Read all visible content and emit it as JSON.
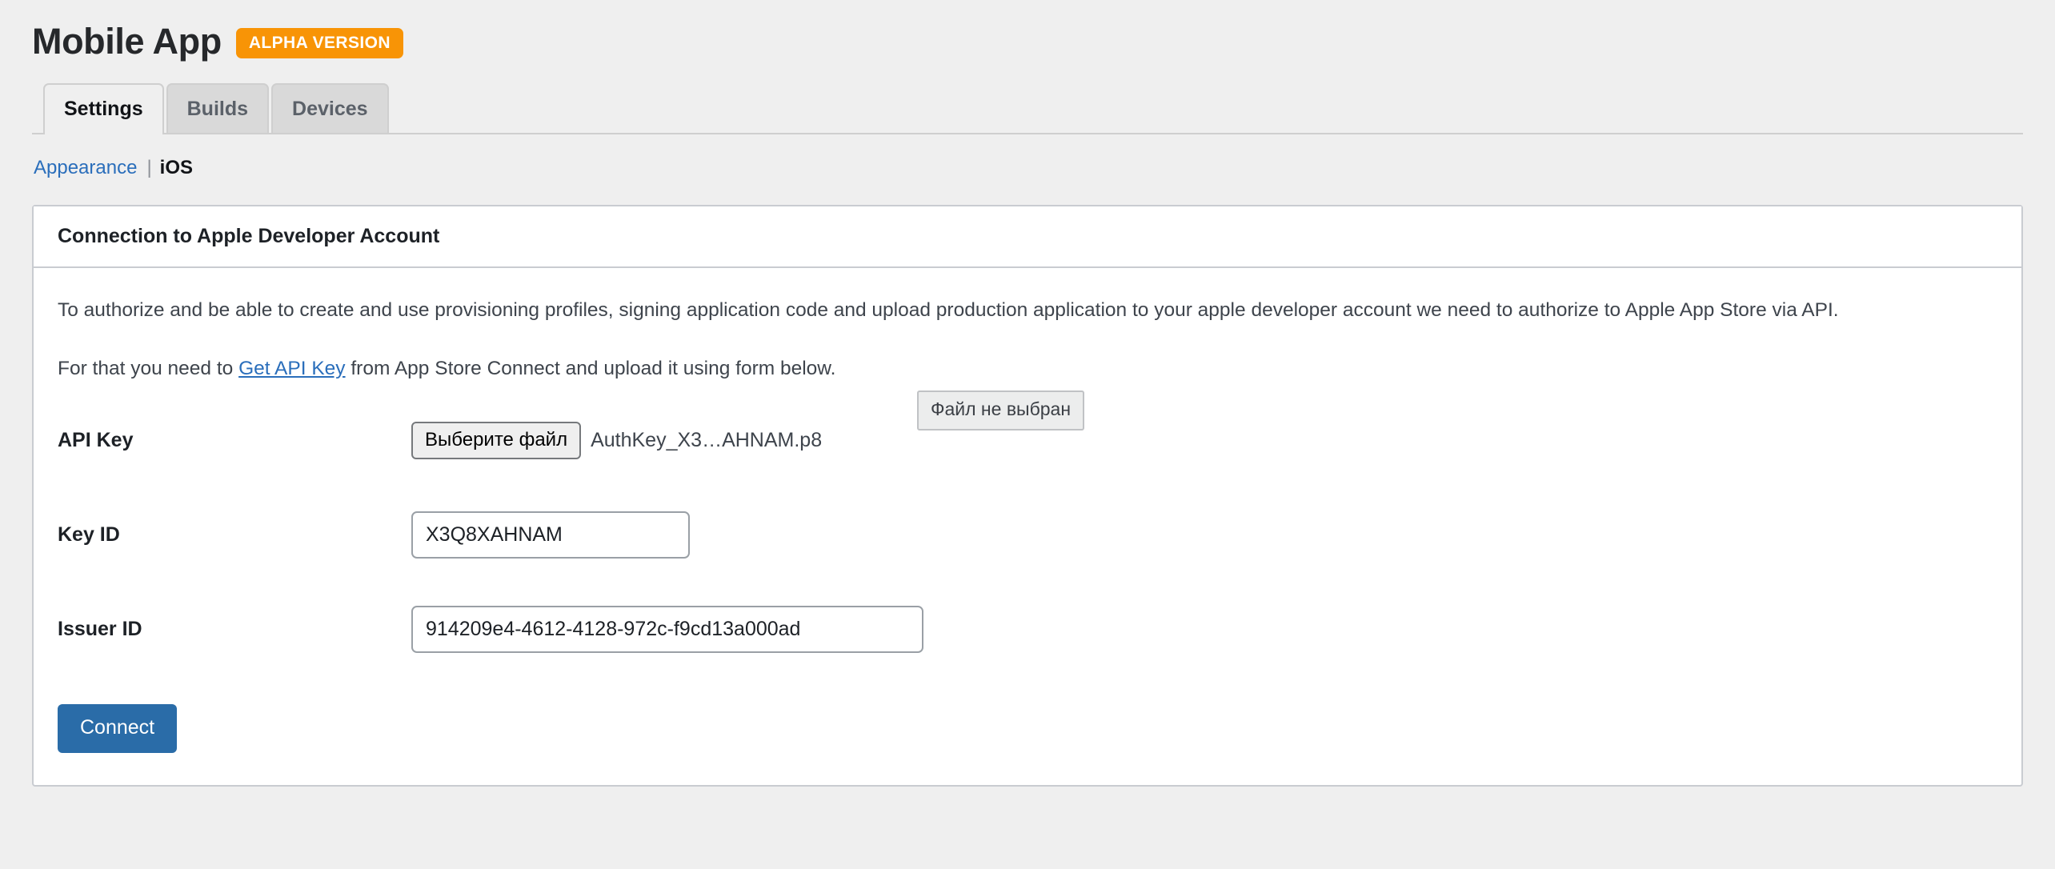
{
  "header": {
    "app_title": "Mobile App",
    "badge": "ALPHA VERSION",
    "badge_color": "#f89406"
  },
  "tabs": [
    {
      "label": "Settings",
      "active": true
    },
    {
      "label": "Builds",
      "active": false
    },
    {
      "label": "Devices",
      "active": false
    }
  ],
  "subnav": {
    "link": "Appearance",
    "separator": "|",
    "current": "iOS"
  },
  "panel": {
    "title": "Connection to Apple Developer Account",
    "paragraph_1": "To authorize and be able to create and use provisioning profiles, signing application code and upload production application to your apple developer account we need to authorize to Apple App Store via API.",
    "paragraph_2_before": "For that you need to ",
    "paragraph_2_link": "Get API Key",
    "paragraph_2_after": " from App Store Connect and upload it using form below."
  },
  "form": {
    "api_key": {
      "label": "API Key",
      "button_label": "Выберите файл",
      "file_name": "AuthKey_X3…AHNAM.p8"
    },
    "key_id": {
      "label": "Key ID",
      "value": "X3Q8XAHNAM",
      "placeholder": ""
    },
    "issuer_id": {
      "label": "Issuer ID",
      "value": "914209e4-4612-4128-972c-f9cd13a000ad",
      "placeholder": ""
    },
    "submit_label": "Connect",
    "submit_color": "#2a6ca8"
  },
  "tooltip": {
    "text": "Файл не выбран"
  }
}
